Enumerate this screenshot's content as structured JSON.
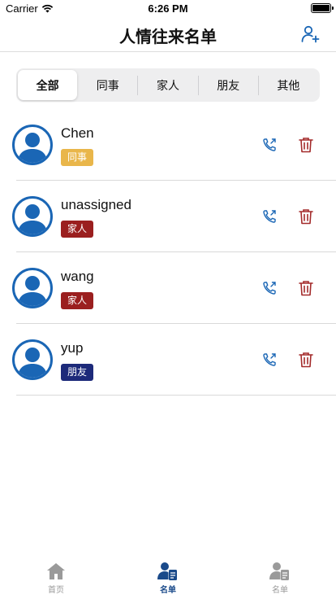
{
  "status_bar": {
    "carrier": "Carrier",
    "time": "6:26 PM"
  },
  "nav": {
    "title": "人情往来名单",
    "add_icon": "add-user-icon"
  },
  "segments": [
    {
      "label": "全部",
      "active": true
    },
    {
      "label": "同事",
      "active": false
    },
    {
      "label": "家人",
      "active": false
    },
    {
      "label": "朋友",
      "active": false
    },
    {
      "label": "其他",
      "active": false
    }
  ],
  "contacts": [
    {
      "name": "Chen",
      "tag": "同事",
      "tag_color": "#e9b64a"
    },
    {
      "name": "unassigned",
      "tag": "家人",
      "tag_color": "#9b1f1f"
    },
    {
      "name": "wang",
      "tag": "家人",
      "tag_color": "#9b1f1f"
    },
    {
      "name": "yup",
      "tag": "朋友",
      "tag_color": "#1d2a7a"
    }
  ],
  "colors": {
    "accent": "#1a66b5",
    "delete": "#a32a2a",
    "tab_active": "#1a4a8a"
  },
  "tabbar": [
    {
      "label": "首页",
      "icon": "home-icon",
      "active": false
    },
    {
      "label": "名单",
      "icon": "contact-list-icon",
      "active": true
    },
    {
      "label": "名单",
      "icon": "contact-list-icon",
      "active": false
    }
  ]
}
